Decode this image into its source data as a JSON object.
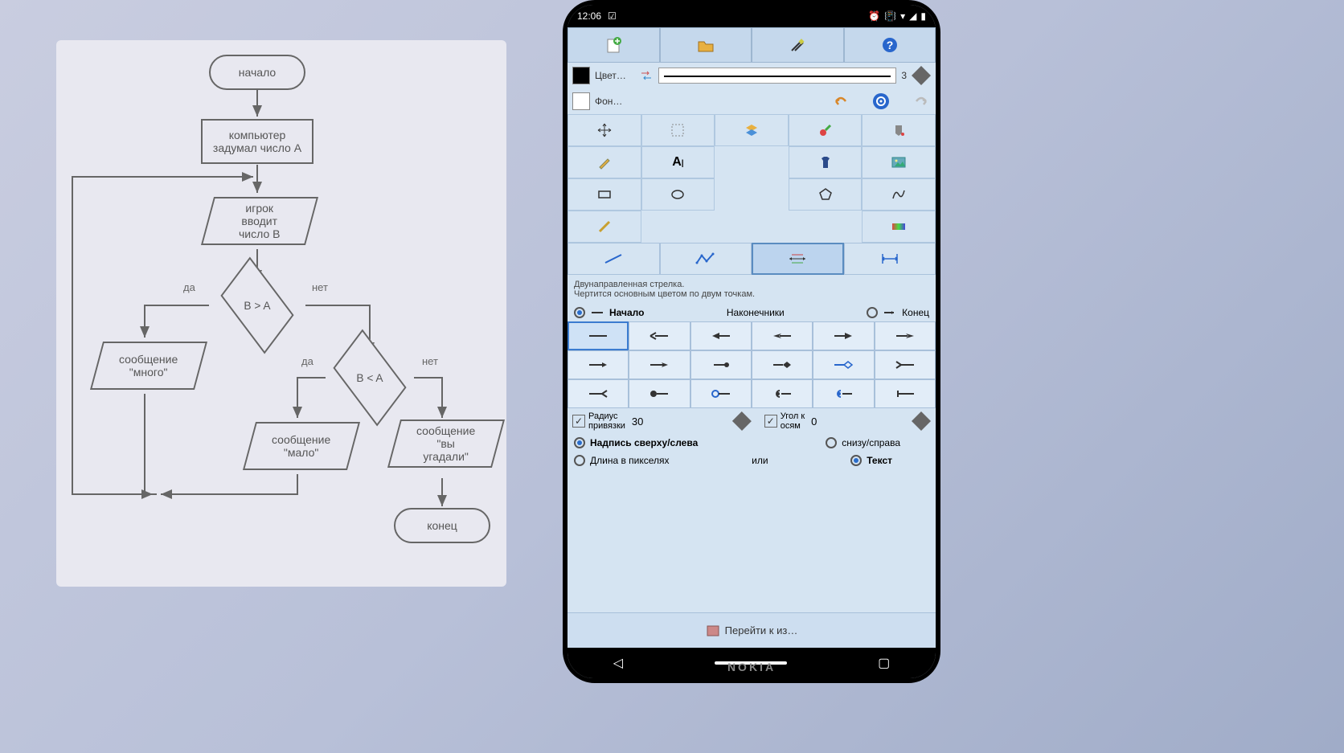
{
  "flowchart": {
    "start": "начало",
    "compute": "компьютер\nзадумал число A",
    "input": "игрок\nвводит\nчисло B",
    "cond1": "B > A",
    "cond2": "B < A",
    "msg_many": "сообщение\n\"много\"",
    "msg_few": "сообщение\n\"мало\"",
    "msg_win": "сообщение\n\"вы\nугадали\"",
    "end": "конец",
    "yes": "да",
    "no": "нет"
  },
  "phone": {
    "brand": "NOKIA",
    "status": {
      "time": "12:06"
    },
    "toolbar": {
      "color_label": "Цвет…",
      "bg_label": "Фон…",
      "stroke_width": "3"
    },
    "tool_desc_title": "Двунаправленная стрелка.",
    "tool_desc_body": "Чертится основным цветом по двум точкам.",
    "caps": {
      "header": "Наконечники",
      "start": "Начало",
      "end": "Конец"
    },
    "params": {
      "snap_radius_label": "Радиус\nпривязки",
      "snap_radius_value": "30",
      "axis_angle_label": "Угол к\nосям",
      "axis_angle_value": "0"
    },
    "caption": {
      "top_left": "Надпись сверху/слева",
      "bottom_right": "снизу/справа"
    },
    "dimension": {
      "pixels": "Длина в пикселях",
      "or": "или",
      "text": "Текст"
    },
    "go_button": "Перейти к из…"
  }
}
